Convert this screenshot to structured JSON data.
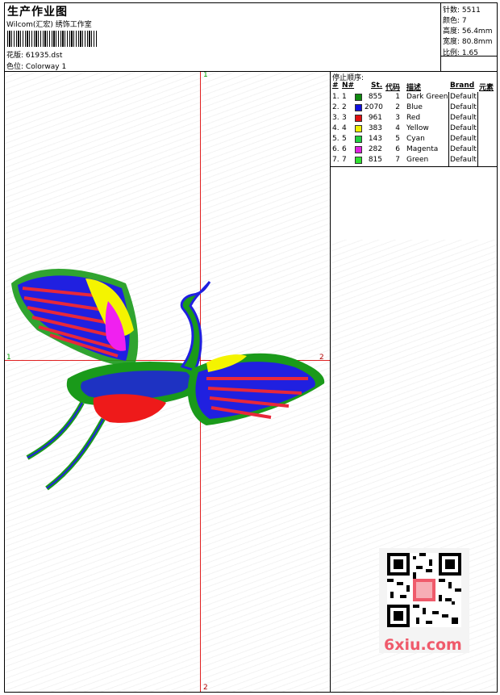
{
  "header": {
    "title": "生产作业图",
    "company": "Wilcom(汇宏) 绣饰工作室",
    "file_label": "花版:",
    "file_name": "61935.dst",
    "colorway_label": "色位:",
    "colorway_name": "Colorway 1"
  },
  "stats": {
    "stitches": "针数: 5511",
    "colors": "颜色: 7",
    "height": "高度: 56.4mm",
    "width": "宽度: 80.8mm",
    "scale": "比例: 1.65"
  },
  "canvas": {
    "top_marker": "1",
    "left_marker": "1",
    "right_marker": "2",
    "bottom_marker": "2"
  },
  "stop_sequence": {
    "title": "停止顺序:",
    "columns": [
      "#",
      "N#",
      "St.",
      "代码",
      "描述",
      "Brand",
      "元素"
    ],
    "rows": [
      {
        "idx": "1.",
        "n": "1",
        "color": "#108a10",
        "st": "855",
        "code": "1",
        "desc": "Dark Green",
        "brand": "Default"
      },
      {
        "idx": "2.",
        "n": "2",
        "color": "#1010e0",
        "st": "2070",
        "code": "2",
        "desc": "Blue",
        "brand": "Default"
      },
      {
        "idx": "3.",
        "n": "3",
        "color": "#e01010",
        "st": "961",
        "code": "3",
        "desc": "Red",
        "brand": "Default"
      },
      {
        "idx": "4.",
        "n": "4",
        "color": "#f0f000",
        "st": "383",
        "code": "4",
        "desc": "Yellow",
        "brand": "Default"
      },
      {
        "idx": "5.",
        "n": "5",
        "color": "#20d040",
        "st": "143",
        "code": "5",
        "desc": "Cyan",
        "brand": "Default"
      },
      {
        "idx": "6.",
        "n": "6",
        "color": "#e020e0",
        "st": "282",
        "code": "6",
        "desc": "Magenta",
        "brand": "Default"
      },
      {
        "idx": "7.",
        "n": "7",
        "color": "#30e030",
        "st": "815",
        "code": "7",
        "desc": "Green",
        "brand": "Default"
      }
    ]
  },
  "watermark": {
    "text": "6xiu.com"
  }
}
